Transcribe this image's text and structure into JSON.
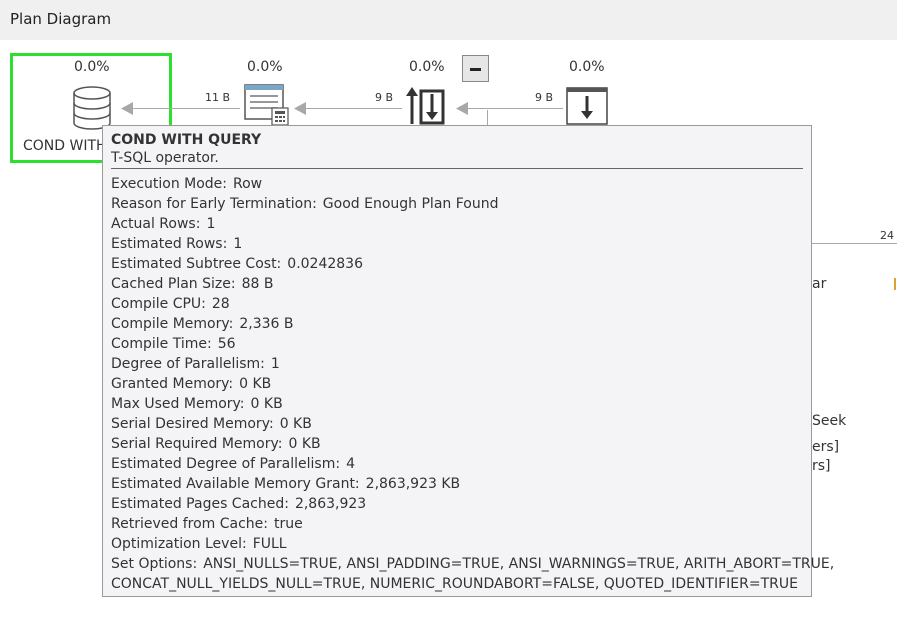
{
  "header": {
    "title": "Plan Diagram"
  },
  "diagram": {
    "nodes": [
      {
        "cost": "0.0%",
        "label": "COND WITH",
        "icon": "database-icon"
      },
      {
        "cost": "0.0%",
        "icon": "compute-scalar-icon"
      },
      {
        "cost": "0.0%",
        "icon": "sequence-icon"
      },
      {
        "cost": "0.0%",
        "icon": "table-insert-icon"
      }
    ],
    "edges": [
      {
        "label": "11 B"
      },
      {
        "label": "9 B"
      },
      {
        "label": "9 B"
      },
      {
        "label": "24"
      }
    ],
    "fragments": [
      "ar",
      "Seek",
      "ers]",
      "rs]"
    ]
  },
  "tooltip": {
    "title": "COND WITH QUERY",
    "subtitle": "T-SQL operator.",
    "rows": [
      {
        "label": "Execution Mode:",
        "value": "Row"
      },
      {
        "label": "Reason for Early Termination:",
        "value": "Good Enough Plan Found"
      },
      {
        "label": "Actual Rows:",
        "value": "1"
      },
      {
        "label": "Estimated Rows:",
        "value": "1"
      },
      {
        "label": "Estimated Subtree Cost:",
        "value": "0.0242836"
      },
      {
        "label": "Cached Plan Size:",
        "value": "88 B"
      },
      {
        "label": "Compile CPU:",
        "value": "28"
      },
      {
        "label": "Compile Memory:",
        "value": "2,336 B"
      },
      {
        "label": "Compile Time:",
        "value": "56"
      },
      {
        "label": "Degree of Parallelism:",
        "value": "1"
      },
      {
        "label": "Granted Memory:",
        "value": "0 KB"
      },
      {
        "label": "Max Used Memory:",
        "value": "0 KB"
      },
      {
        "label": "Serial Desired Memory:",
        "value": "0 KB"
      },
      {
        "label": "Serial Required Memory:",
        "value": "0 KB"
      },
      {
        "label": "Estimated Degree of Parallelism:",
        "value": "4"
      },
      {
        "label": "Estimated Available Memory Grant:",
        "value": "2,863,923 KB"
      },
      {
        "label": "Estimated Pages Cached:",
        "value": "2,863,923"
      },
      {
        "label": "Retrieved from Cache:",
        "value": "true"
      },
      {
        "label": "Optimization Level:",
        "value": "FULL"
      },
      {
        "label": "Set Options:",
        "value": "ANSI_NULLS=TRUE, ANSI_PADDING=TRUE, ANSI_WARNINGS=TRUE, ARITH_ABORT=TRUE,"
      }
    ],
    "set_options_continued": "CONCAT_NULL_YIELDS_NULL=TRUE, NUMERIC_ROUNDABORT=FALSE, QUOTED_IDENTIFIER=TRUE"
  }
}
